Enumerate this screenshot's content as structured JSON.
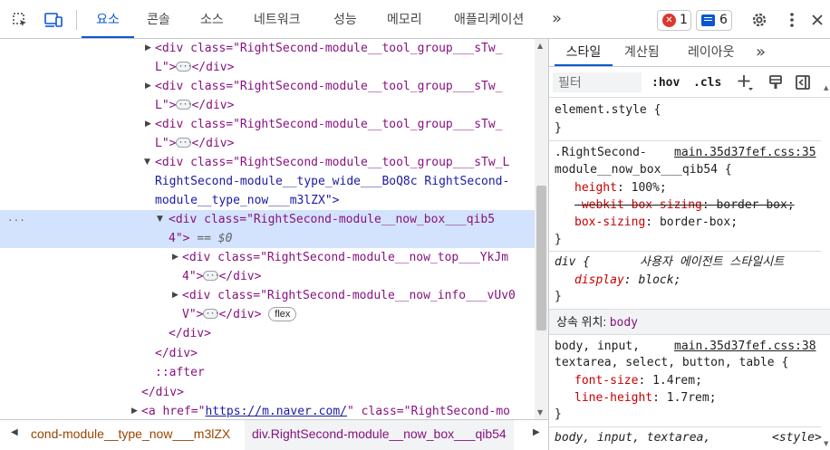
{
  "toolbar": {
    "tabs": [
      "요소",
      "콘솔",
      "소스",
      "네트워크",
      "성능",
      "메모리",
      "애플리케이션"
    ],
    "more": "»",
    "error_count": "1",
    "message_count": "6"
  },
  "dom": {
    "l1a": "<div class=\"RightSecond-module__tool_group___sTw_",
    "l1b": "L\">",
    "l2a": "<div class=\"RightSecond-module__tool_group___sTw_",
    "l2b": "L\">",
    "l3a": "<div class=\"RightSecond-module__tool_group___sTw_",
    "l3b": "L\">",
    "l4a": "<div class=\"RightSecond-module__tool_group___sTw_L",
    "l4b": "RightSecond-module__type_wide___BoQ8c RightSecond-",
    "l4c": "module__type_now___m3lZX\">",
    "l5a": "<div class=\"RightSecond-module__now_box___qib5",
    "l5b": "4\">",
    "l5c": "== $0",
    "l6a": "<div class=\"RightSecond-module__now_top___YkJm",
    "l6b": "4\">",
    "l7a": "<div class=\"RightSecond-module__now_info___vUv0",
    "l7b": "V\">",
    "flex": "flex",
    "close_div": "</div>",
    "after": "::after",
    "l8a": "<a href=\"",
    "l8link": "https://m.naver.com/",
    "l8b": "\" class=\"RightSecond-mo",
    "dots": "···"
  },
  "breadcrumb": {
    "left_arrow": "◀",
    "item1": "cond-module__type_now___m3lZX",
    "item2": "div.RightSecond-module__now_box___qib54",
    "right_arrow": "▶"
  },
  "styles": {
    "tabs": [
      "스타일",
      "계산됨",
      "레이아웃"
    ],
    "more": "»",
    "filter_placeholder": "필터",
    "hov": ":hov",
    "cls": ".cls",
    "element_style": "element.style {",
    "close_brace": "}",
    "rule1_sel_a": ".RightSecond-",
    "rule1_src": "main.35d37fef.css:35",
    "rule1_sel_b": "module__now_box___qib54 {",
    "rule1_p1": "height",
    "rule1_v1": "100%;",
    "rule1_p2": "-webkit-box-sizing",
    "rule1_v2": "border-box;",
    "rule1_p3": "box-sizing",
    "rule1_v3": "border-box;",
    "rule2_sel": "div {",
    "rule2_ua": "사용자 에이전트 스타일시트",
    "rule2_p1": "display",
    "rule2_v1": "block;",
    "inherited_label": "상속 위치: ",
    "inherited_from": "body",
    "rule3_sel_a": "body, input,",
    "rule3_src": "main.35d37fef.css:38",
    "rule3_sel_b": "textarea, select, button, table {",
    "rule3_p1": "font-size",
    "rule3_v1": "1.4rem;",
    "rule3_p2": "line-height",
    "rule3_v2": "1.7rem;",
    "rule4_sel": "body, input, textarea,",
    "rule4_src": "<style>"
  },
  "colors": {
    "accent": "#0b57d0",
    "error": "#dc362e",
    "selection": "#d3e3fd"
  }
}
